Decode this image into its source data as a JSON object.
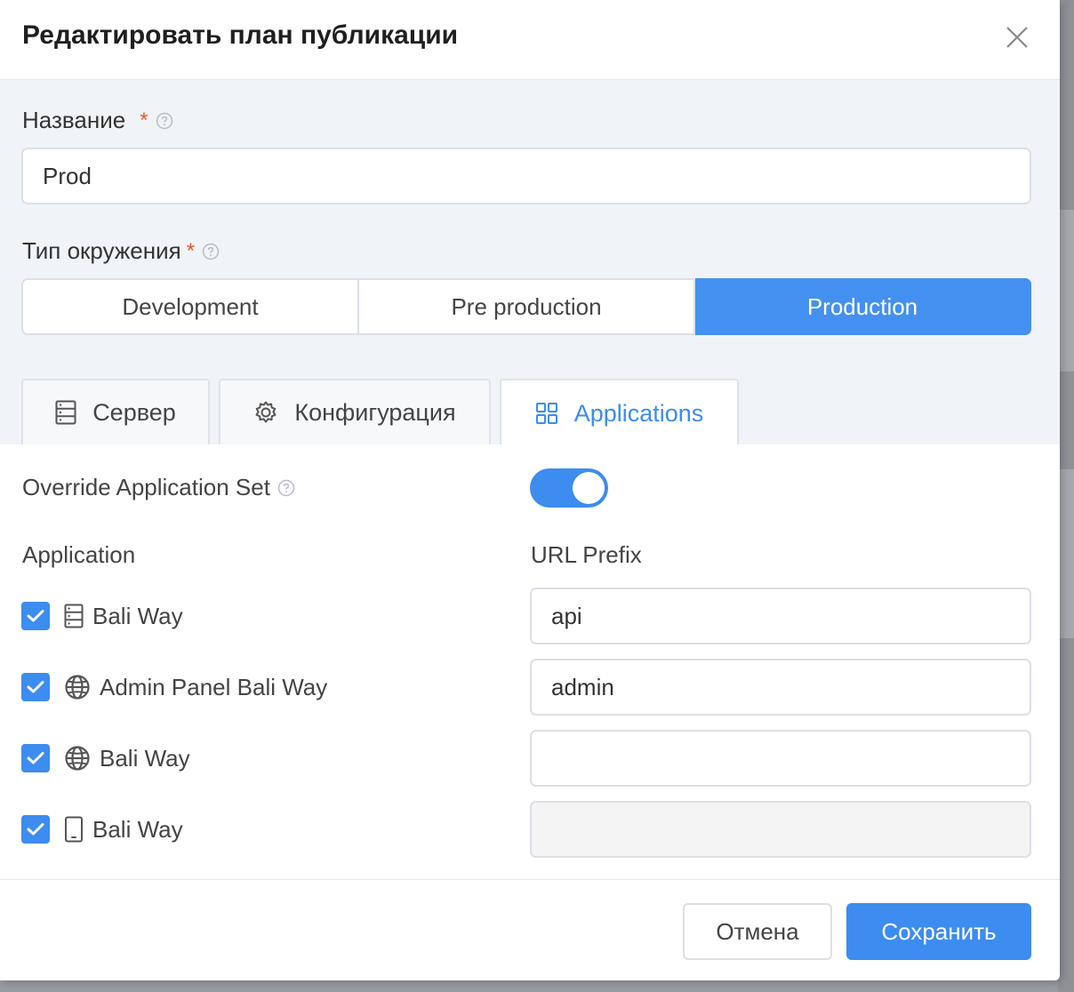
{
  "modal": {
    "title": "Редактировать план публикации"
  },
  "name_field": {
    "label": "Название",
    "required_mark": "*",
    "value": "Prod"
  },
  "env_type": {
    "label": "Тип окружения",
    "required_mark": "*",
    "options": [
      "Development",
      "Pre production",
      "Production"
    ],
    "selected": "Production"
  },
  "tabs": [
    {
      "label": "Сервер",
      "icon": "server-icon"
    },
    {
      "label": "Конфигурация",
      "icon": "gear-icon"
    },
    {
      "label": "Applications",
      "icon": "grid-icon",
      "active": true
    }
  ],
  "applications_tab": {
    "override_label": "Override Application Set",
    "override_enabled": true,
    "col_application": "Application",
    "col_url_prefix": "URL Prefix",
    "rows": [
      {
        "checked": true,
        "icon": "server-icon",
        "name": "Bali Way",
        "url_prefix": "api",
        "disabled": false
      },
      {
        "checked": true,
        "icon": "globe-icon",
        "name": "Admin Panel Bali Way",
        "url_prefix": "admin",
        "disabled": false
      },
      {
        "checked": true,
        "icon": "globe-icon",
        "name": "Bali Way",
        "url_prefix": "",
        "disabled": false
      },
      {
        "checked": true,
        "icon": "mobile-icon",
        "name": "Bali Way",
        "url_prefix": "",
        "disabled": true
      }
    ]
  },
  "footer": {
    "cancel_label": "Отмена",
    "save_label": "Сохранить"
  },
  "colors": {
    "accent": "#3d8cf0",
    "required": "#e8562a"
  }
}
